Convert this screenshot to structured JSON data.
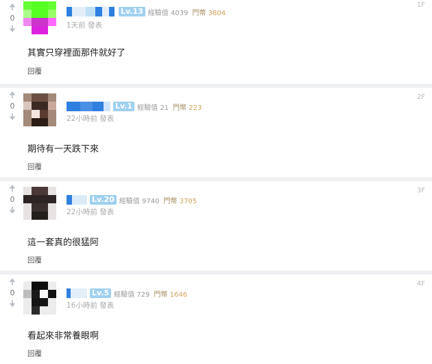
{
  "comments": [
    {
      "floor": "1F",
      "level": "Lv.13",
      "exp_label": "經驗值",
      "exp": "4039",
      "gp_label": "門幣",
      "gp": "3804",
      "time": "1天前 發表",
      "vote_count": "0",
      "text": "其實只穿裡面那件就好了",
      "reply": "回覆"
    },
    {
      "floor": "2F",
      "level": "Lv.1",
      "exp_label": "經驗值",
      "exp": "21",
      "gp_label": "門幣",
      "gp": "223",
      "time": "22小時前 發表",
      "vote_count": "0",
      "text": "期待有一天跌下來",
      "reply": "回覆"
    },
    {
      "floor": "3F",
      "level": "Lv.20",
      "exp_label": "經驗值",
      "exp": "9740",
      "gp_label": "門幣",
      "gp": "3705",
      "time": "22小時前 發表",
      "vote_count": "0",
      "text": "這一套真的很猛阿",
      "reply": "回覆"
    },
    {
      "floor": "4F",
      "level": "Lv.5",
      "exp_label": "經驗值",
      "exp": "729",
      "gp_label": "門幣",
      "gp": "1646",
      "time": "16小時前 發表",
      "vote_count": "0",
      "text": "看起來非常養眼啊",
      "reply": "回覆"
    }
  ],
  "colors": {
    "level_badge": "#9fd0ef",
    "gp": "#d2a25a",
    "separator": "#eef0f2"
  },
  "icons": {
    "upvote": "arrow-up-icon",
    "downvote": "arrow-down-icon"
  }
}
